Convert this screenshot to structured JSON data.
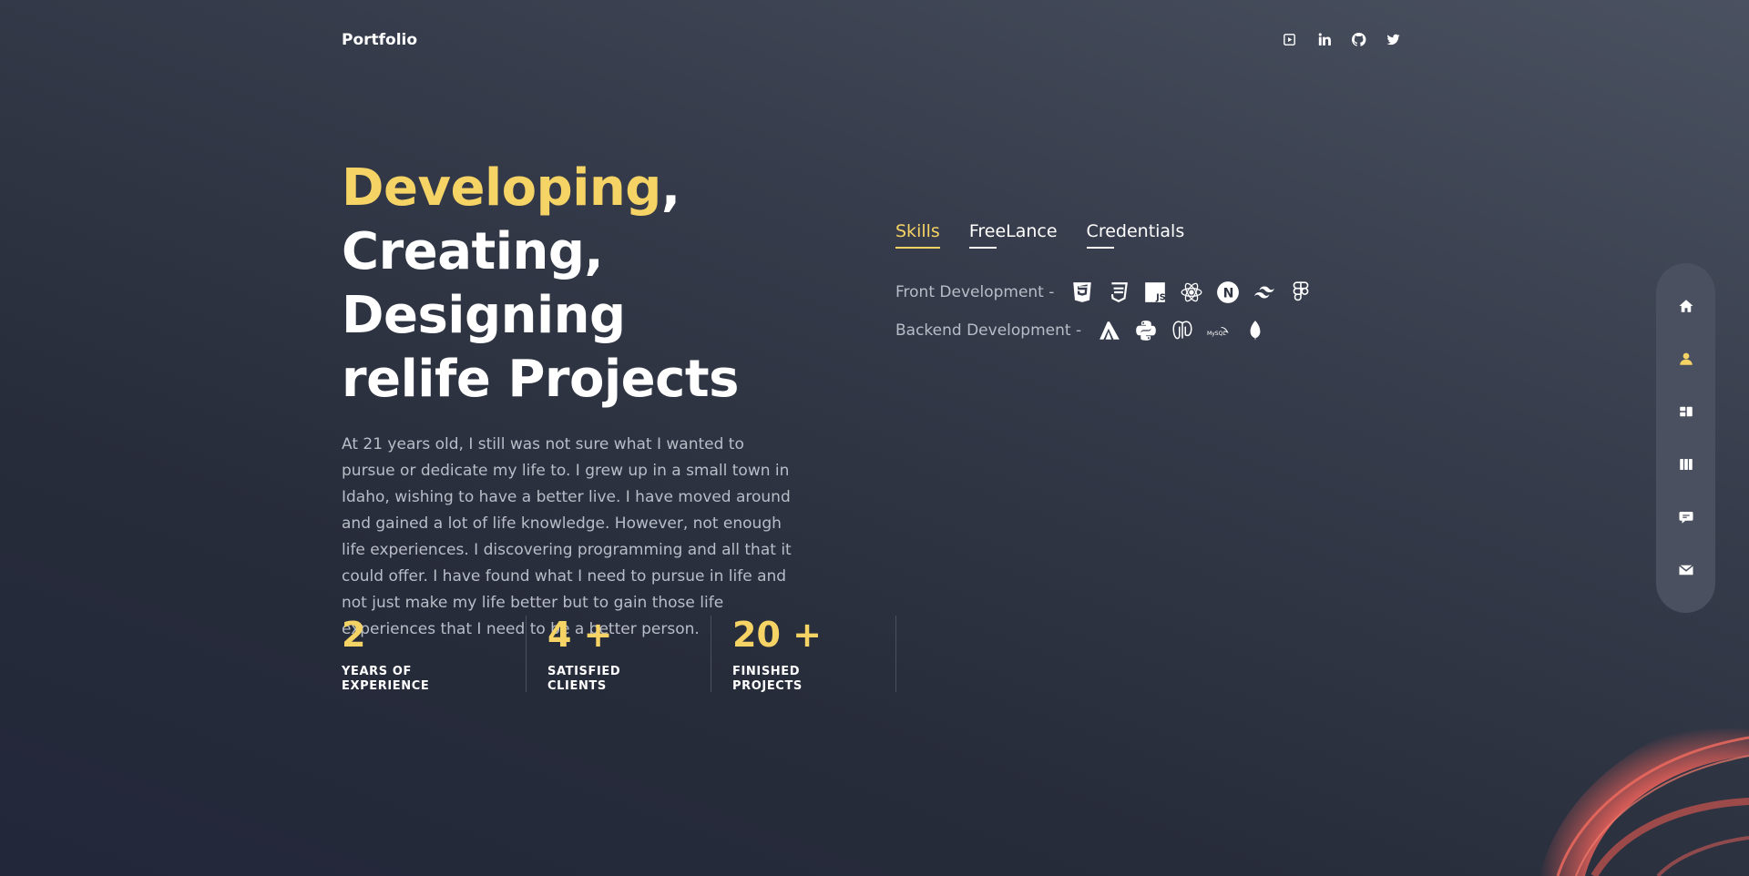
{
  "header": {
    "logo": "Portfolio",
    "socials": [
      {
        "name": "youtube-icon"
      },
      {
        "name": "linkedin-icon"
      },
      {
        "name": "github-icon"
      },
      {
        "name": "twitter-icon"
      }
    ]
  },
  "hero": {
    "headline_accent": "Developing",
    "headline_comma": ",",
    "headline_line2": "Creating, Designing",
    "headline_line3": "relife Projects",
    "bio": "At 21 years old, I still was not sure what I wanted to pursue or dedicate my life to. I grew up in a small town in Idaho, wishing to have a better live. I have moved around and gained a lot of life knowledge. However, not enough life experiences. I discovering programming and all that it could offer. I have found what I need to pursue in life and not just make my life better but to gain those life experiences that I need to be a better person."
  },
  "stats": [
    {
      "value": "2",
      "label": "YEARS OF\nEXPERIENCE"
    },
    {
      "value": "4 +",
      "label": "SATISFIED\nCLIENTS"
    },
    {
      "value": "20 +",
      "label": "FINISHED\nPROJECTS"
    }
  ],
  "tabs": [
    {
      "label": "Skills",
      "active": true
    },
    {
      "label": "FreeLance",
      "active": false
    },
    {
      "label": "Credentials",
      "active": false
    }
  ],
  "skills": {
    "front_label": "Front Development  -",
    "front_icons": [
      "html5-icon",
      "css3-icon",
      "javascript-icon",
      "react-icon",
      "nextjs-icon",
      "tailwind-icon",
      "figma-icon"
    ],
    "back_label": "Backend Development  -",
    "back_icons": [
      "nestjs-icon",
      "python-icon",
      "postgresql-icon",
      "mysql-icon",
      "mongodb-icon"
    ],
    "mysql_text": "MySQL",
    "js_text": "JS",
    "next_text": "N"
  },
  "sidenav": [
    {
      "name": "home-icon",
      "active": false
    },
    {
      "name": "user-icon",
      "active": true
    },
    {
      "name": "dashboard-icon",
      "active": false
    },
    {
      "name": "portfolio-columns-icon",
      "active": false
    },
    {
      "name": "chat-icon",
      "active": false
    },
    {
      "name": "mail-icon",
      "active": false
    }
  ],
  "colors": {
    "accent": "#f6d365",
    "decoration": "#f0625a"
  }
}
